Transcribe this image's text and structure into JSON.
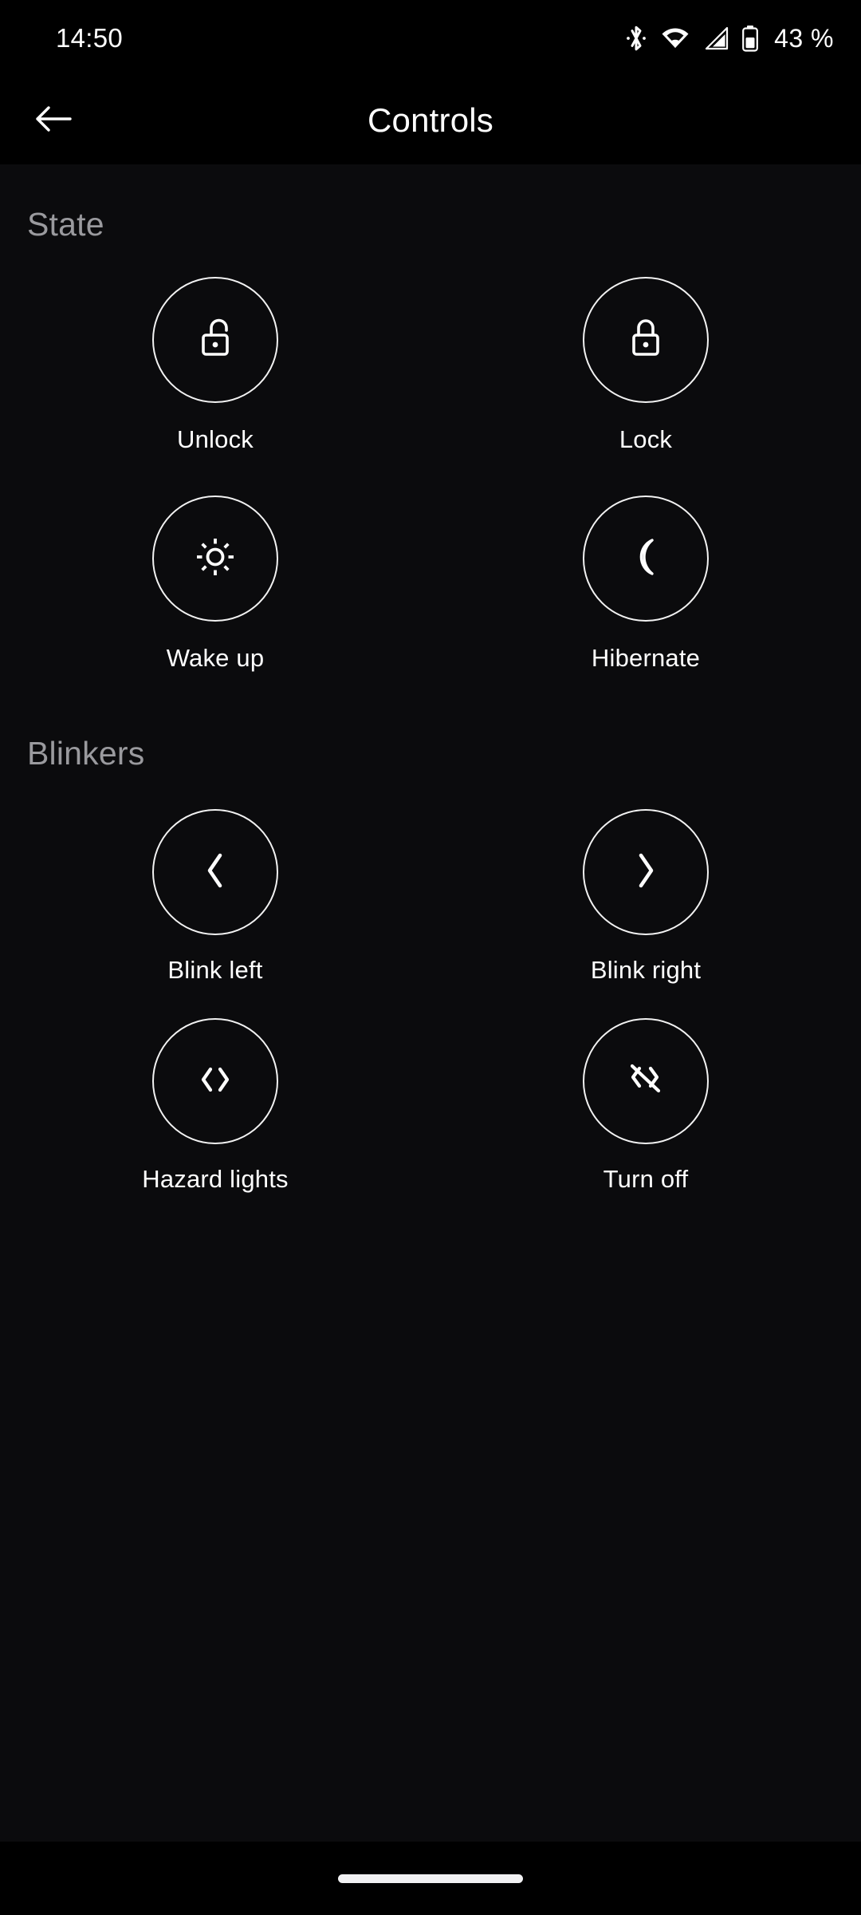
{
  "statusbar": {
    "time": "14:50",
    "battery_percent": "43 %",
    "icons": [
      "bluetooth-icon",
      "wifi-icon",
      "cellular-signal-icon",
      "battery-icon"
    ]
  },
  "appbar": {
    "title": "Controls",
    "back_icon": "arrow-left-icon"
  },
  "sections": [
    {
      "title": "State",
      "items": [
        {
          "label": "Unlock",
          "icon": "lock-open-icon"
        },
        {
          "label": "Lock",
          "icon": "lock-closed-icon"
        },
        {
          "label": "Wake up",
          "icon": "sun-icon"
        },
        {
          "label": "Hibernate",
          "icon": "moon-icon"
        }
      ]
    },
    {
      "title": "Blinkers",
      "items": [
        {
          "label": "Blink left",
          "icon": "chevron-left-icon"
        },
        {
          "label": "Blink right",
          "icon": "chevron-right-icon"
        },
        {
          "label": "Hazard lights",
          "icon": "hazard-lights-icon"
        },
        {
          "label": "Turn off",
          "icon": "hazard-lights-off-icon"
        }
      ]
    }
  ],
  "navbar": {
    "handle": "gesture-home-handle"
  },
  "colors": {
    "background": "#000000",
    "content_background": "#0b0b0d",
    "section_title": "#9a9a9e",
    "label": "#ffffff",
    "circle_stroke": "#f2f2f2"
  }
}
